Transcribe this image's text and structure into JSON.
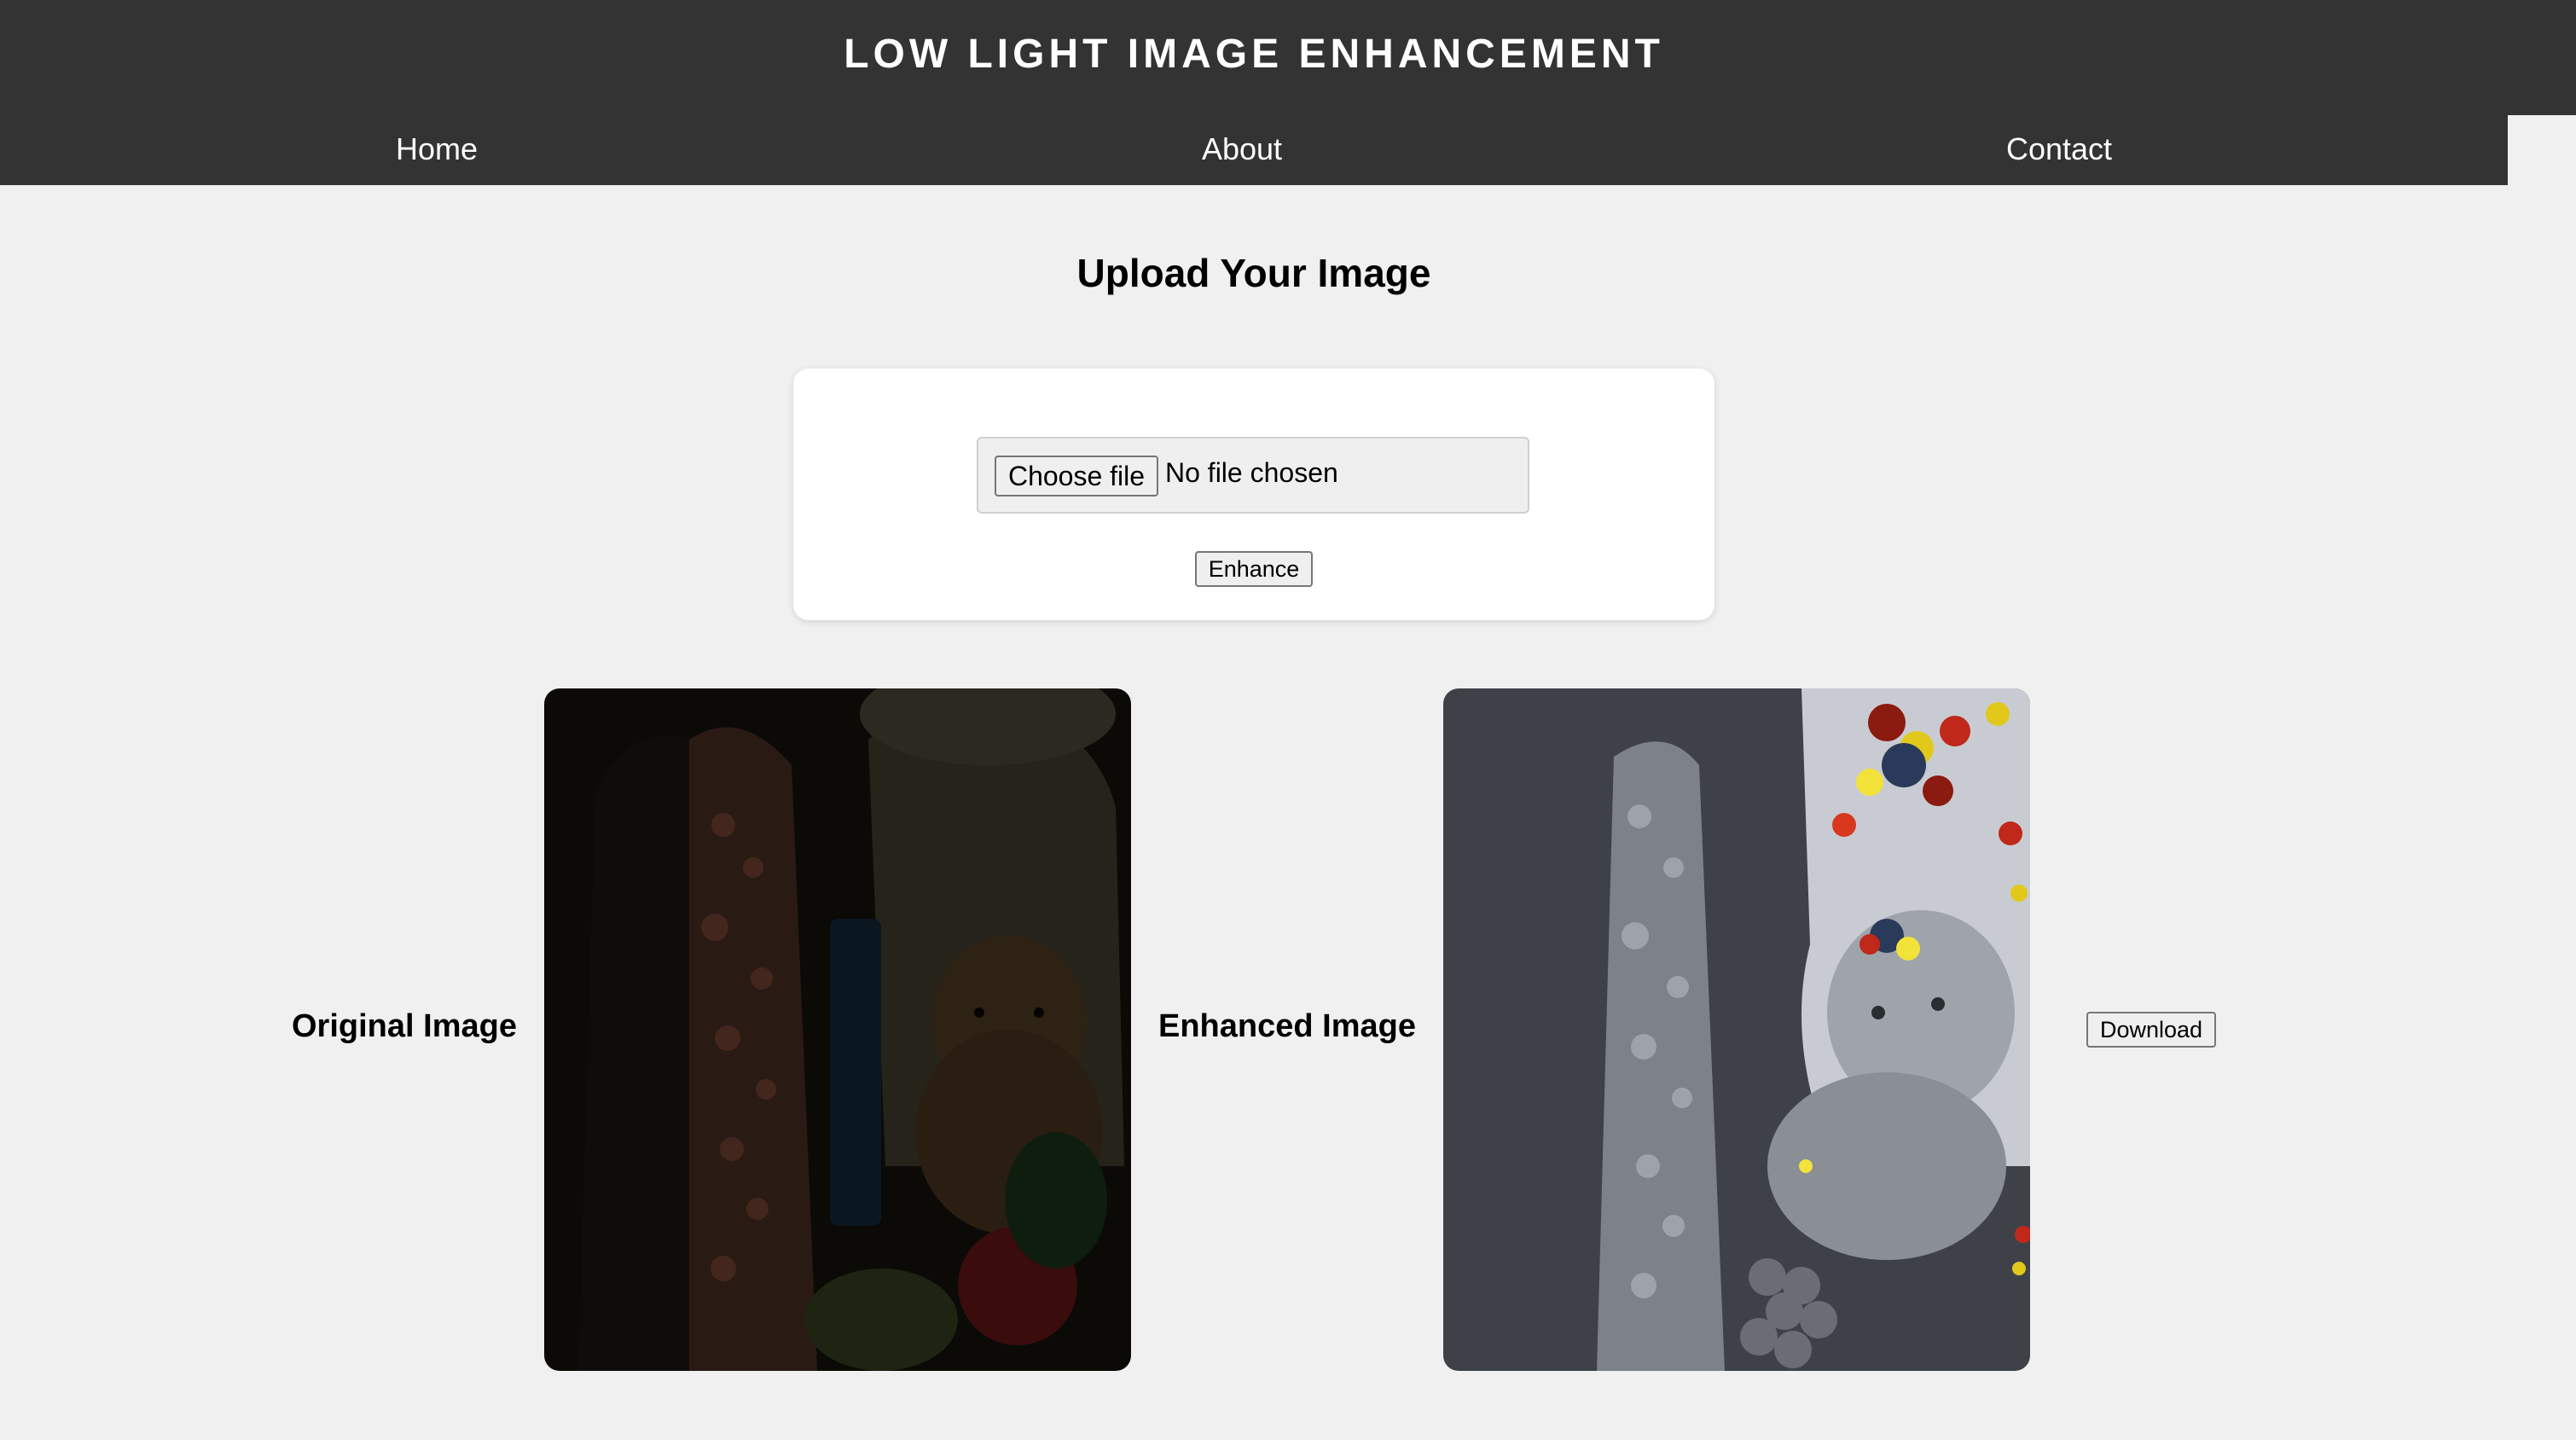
{
  "header": {
    "title": "LOW LIGHT IMAGE ENHANCEMENT",
    "nav": [
      {
        "label": "Home"
      },
      {
        "label": "About"
      },
      {
        "label": "Contact"
      }
    ]
  },
  "upload": {
    "heading": "Upload Your Image",
    "choose_label": "Choose file",
    "file_status": "No file chosen",
    "enhance_label": "Enhance"
  },
  "results": {
    "original_label": "Original Image",
    "enhanced_label": "Enhanced Image",
    "download_label": "Download"
  },
  "colors": {
    "header_bg": "#333333",
    "page_bg": "#f0f0f0",
    "card_bg": "#ffffff"
  }
}
